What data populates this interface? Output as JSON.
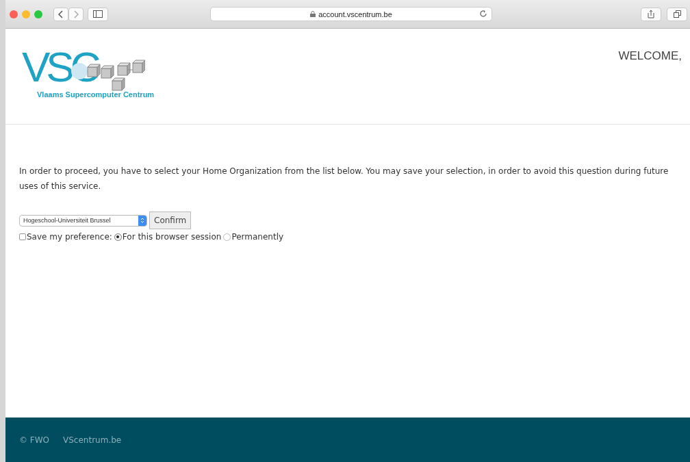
{
  "browser": {
    "url": "account.vscentrum.be"
  },
  "header": {
    "logo_letters": "VSC",
    "logo_caption": "Vlaams Supercomputer Centrum",
    "welcome": "WELCOME,"
  },
  "intro": "In order to proceed, you have to select your Home Organization from the list below. You may save your selection, in order to avoid this question during future uses of this service.",
  "organization_select": {
    "value": "Hogeschool-Universiteit Brussel"
  },
  "confirm_button": "Confirm",
  "save_preference": {
    "label": "Save my preference:",
    "checked": false
  },
  "options": [
    {
      "label": "For this browser session",
      "selected": true
    },
    {
      "label": "Permanently",
      "selected": false
    }
  ],
  "footer": {
    "links": [
      "© FWO",
      "VScentrum.be"
    ]
  }
}
